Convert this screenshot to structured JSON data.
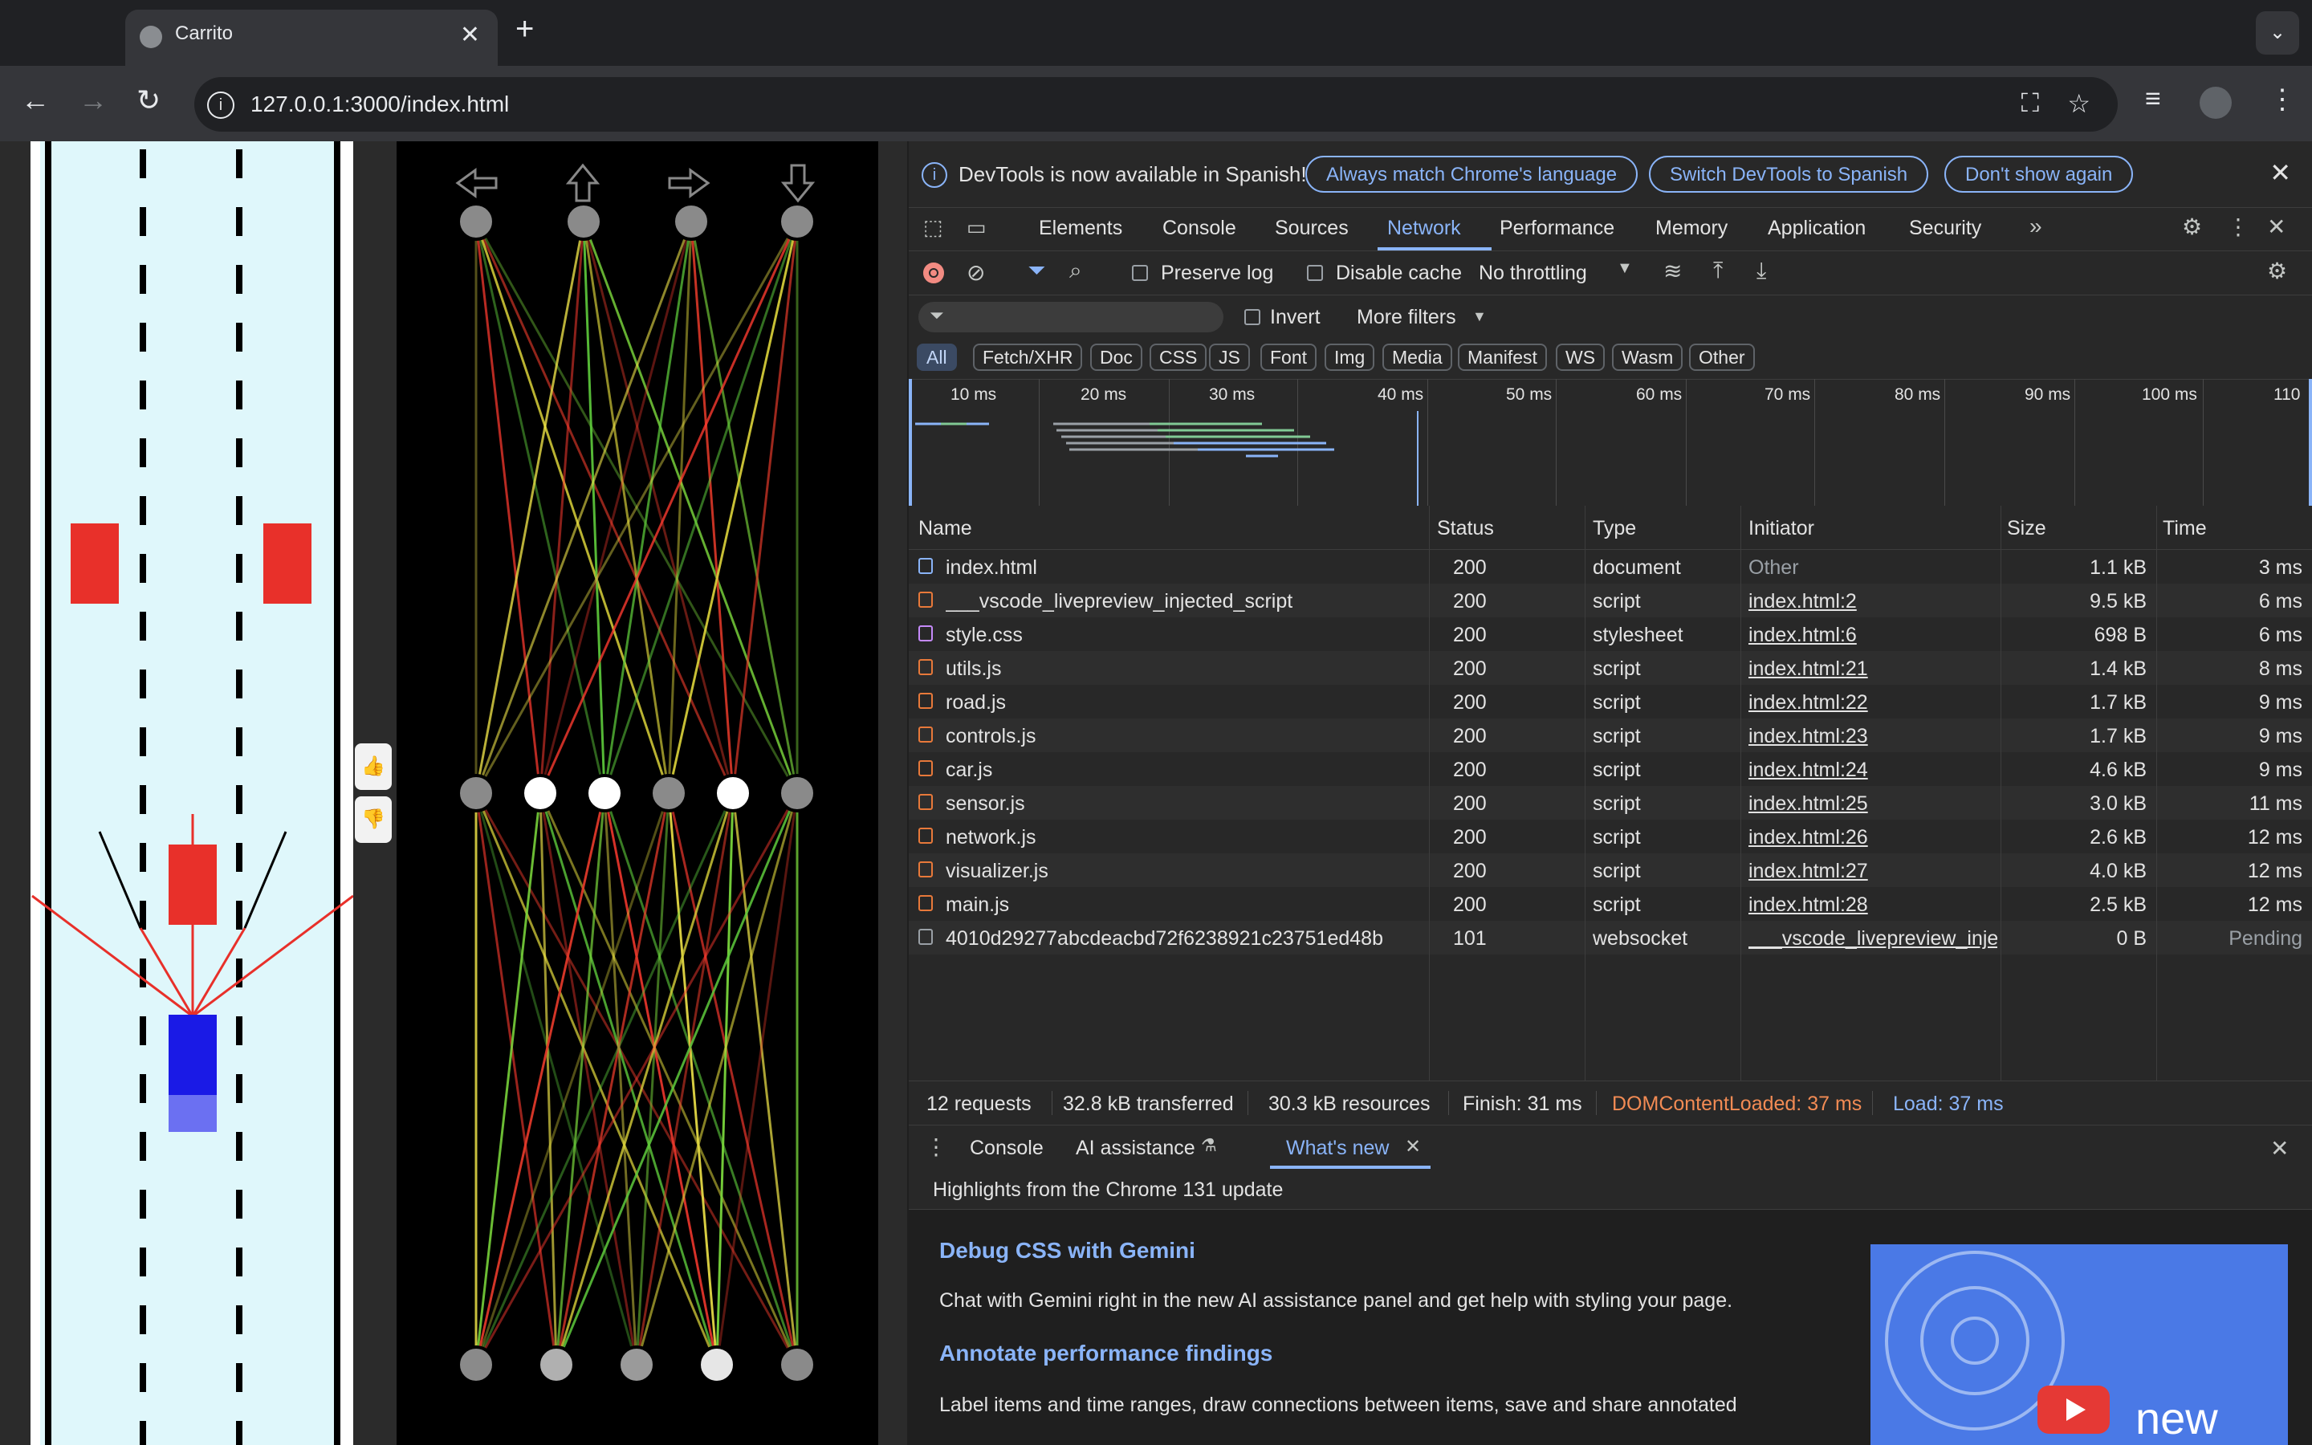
{
  "browser": {
    "tab_title": "Carrito",
    "url": "127.0.0.1:3000/index.html"
  },
  "devtools": {
    "infobar": {
      "message": "DevTools is now available in Spanish!",
      "btn_match": "Always match Chrome's language",
      "btn_switch": "Switch DevTools to Spanish",
      "btn_dont": "Don't show again"
    },
    "tabs": [
      "Elements",
      "Console",
      "Sources",
      "Network",
      "Performance",
      "Memory",
      "Application",
      "Security"
    ],
    "toolbar": {
      "preserve_log": "Preserve log",
      "disable_cache": "Disable cache",
      "throttling": "No throttling"
    },
    "filter": {
      "invert": "Invert",
      "more_filters": "More filters"
    },
    "type_filters": [
      "All",
      "Fetch/XHR",
      "Doc",
      "CSS",
      "JS",
      "Font",
      "Img",
      "Media",
      "Manifest",
      "WS",
      "Wasm",
      "Other"
    ],
    "overview_ticks": [
      "10 ms",
      "20 ms",
      "30 ms",
      "40 ms",
      "50 ms",
      "60 ms",
      "70 ms",
      "80 ms",
      "90 ms",
      "100 ms",
      "110"
    ],
    "columns": [
      "Name",
      "Status",
      "Type",
      "Initiator",
      "Size",
      "Time"
    ],
    "requests": [
      {
        "name": "index.html",
        "status": "200",
        "type": "document",
        "initiator": "Other",
        "size": "1.1 kB",
        "time": "3 ms"
      },
      {
        "name": "___vscode_livepreview_injected_script",
        "status": "200",
        "type": "script",
        "initiator": "index.html:2",
        "size": "9.5 kB",
        "time": "6 ms"
      },
      {
        "name": "style.css",
        "status": "200",
        "type": "stylesheet",
        "initiator": "index.html:6",
        "size": "698 B",
        "time": "6 ms"
      },
      {
        "name": "utils.js",
        "status": "200",
        "type": "script",
        "initiator": "index.html:21",
        "size": "1.4 kB",
        "time": "8 ms"
      },
      {
        "name": "road.js",
        "status": "200",
        "type": "script",
        "initiator": "index.html:22",
        "size": "1.7 kB",
        "time": "9 ms"
      },
      {
        "name": "controls.js",
        "status": "200",
        "type": "script",
        "initiator": "index.html:23",
        "size": "1.7 kB",
        "time": "9 ms"
      },
      {
        "name": "car.js",
        "status": "200",
        "type": "script",
        "initiator": "index.html:24",
        "size": "4.6 kB",
        "time": "9 ms"
      },
      {
        "name": "sensor.js",
        "status": "200",
        "type": "script",
        "initiator": "index.html:25",
        "size": "3.0 kB",
        "time": "11 ms"
      },
      {
        "name": "network.js",
        "status": "200",
        "type": "script",
        "initiator": "index.html:26",
        "size": "2.6 kB",
        "time": "12 ms"
      },
      {
        "name": "visualizer.js",
        "status": "200",
        "type": "script",
        "initiator": "index.html:27",
        "size": "4.0 kB",
        "time": "12 ms"
      },
      {
        "name": "main.js",
        "status": "200",
        "type": "script",
        "initiator": "index.html:28",
        "size": "2.5 kB",
        "time": "12 ms"
      },
      {
        "name": "4010d29277abcdeacbd72f6238921c23751ed48b",
        "status": "101",
        "type": "websocket",
        "initiator": "___vscode_livepreview_inje",
        "size": "0 B",
        "time": "Pending"
      }
    ],
    "summary": {
      "requests": "12 requests",
      "transferred": "32.8 kB transferred",
      "resources": "30.3 kB resources",
      "finish": "Finish: 31 ms",
      "dcl": "DOMContentLoaded: 37 ms",
      "load": "Load: 37 ms"
    },
    "drawer": {
      "tabs": [
        "Console",
        "AI assistance",
        "What's new"
      ],
      "highlights": "Highlights from the Chrome 131 update",
      "h1": "Debug CSS with Gemini",
      "p1": "Chat with Gemini right in the new AI assistance panel and get help with styling your page.",
      "h2": "Annotate performance findings",
      "p2": "Label items and time ranges, draw connections between items, save and share annotated",
      "thumb_text": "new"
    },
    "colors": {
      "accent": "#8ab4f8",
      "dcl": "#f28b54",
      "load": "#8ab4f8"
    }
  }
}
